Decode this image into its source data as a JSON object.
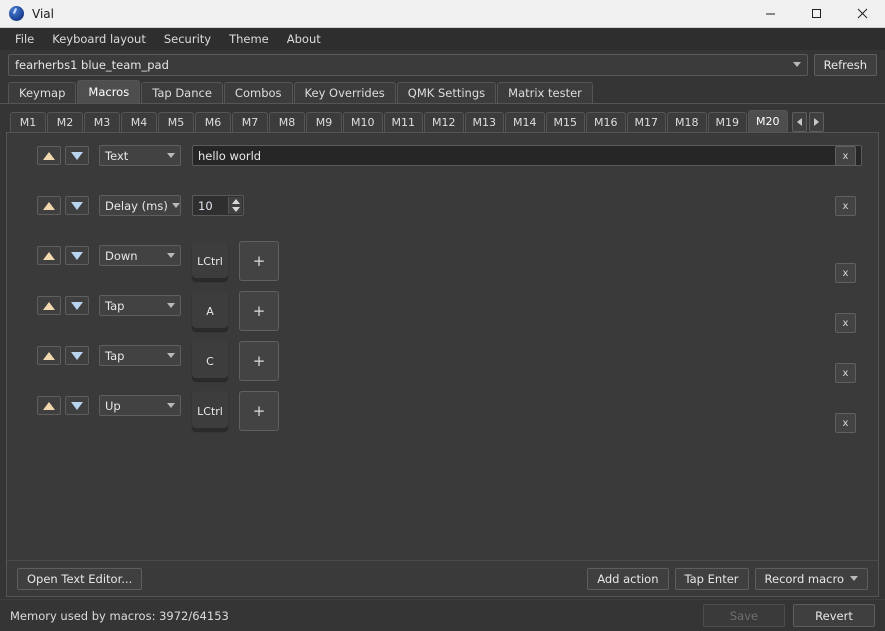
{
  "window": {
    "title": "Vial",
    "icon": "vial-logo-icon",
    "controls": {
      "minimize": "minimize-icon",
      "maximize": "maximize-icon",
      "close": "close-icon"
    }
  },
  "menubar": {
    "items": [
      {
        "label": "File"
      },
      {
        "label": "Keyboard layout"
      },
      {
        "label": "Security"
      },
      {
        "label": "Theme"
      },
      {
        "label": "About"
      }
    ]
  },
  "device": {
    "selected": "fearherbs1 blue_team_pad",
    "refresh_label": "Refresh"
  },
  "main_tabs": {
    "active": "Macros",
    "items": [
      {
        "label": "Keymap"
      },
      {
        "label": "Macros"
      },
      {
        "label": "Tap Dance"
      },
      {
        "label": "Combos"
      },
      {
        "label": "Key Overrides"
      },
      {
        "label": "QMK Settings"
      },
      {
        "label": "Matrix tester"
      }
    ]
  },
  "macro_tabs": {
    "active": "M20",
    "items": [
      {
        "label": "M1"
      },
      {
        "label": "M2"
      },
      {
        "label": "M3"
      },
      {
        "label": "M4"
      },
      {
        "label": "M5"
      },
      {
        "label": "M6"
      },
      {
        "label": "M7"
      },
      {
        "label": "M8"
      },
      {
        "label": "M9"
      },
      {
        "label": "M10"
      },
      {
        "label": "M11"
      },
      {
        "label": "M12"
      },
      {
        "label": "M13"
      },
      {
        "label": "M14"
      },
      {
        "label": "M15"
      },
      {
        "label": "M16"
      },
      {
        "label": "M17"
      },
      {
        "label": "M18"
      },
      {
        "label": "M19"
      },
      {
        "label": "M20"
      }
    ],
    "scroll_left": "scroll-left-icon",
    "scroll_right": "scroll-right-icon"
  },
  "actions": [
    {
      "kind": "text",
      "move_up": "▲",
      "move_down": "▼",
      "type": "Text",
      "value": "hello world",
      "delete": "x"
    },
    {
      "kind": "delay",
      "move_up": "▲",
      "move_down": "▼",
      "type": "Delay (ms)",
      "value": "10",
      "delete": "x"
    },
    {
      "kind": "key",
      "move_up": "▲",
      "move_down": "▼",
      "type": "Down",
      "keys": [
        "LCtrl"
      ],
      "add_key": "+",
      "delete": "x"
    },
    {
      "kind": "key",
      "move_up": "▲",
      "move_down": "▼",
      "type": "Tap",
      "keys": [
        "A"
      ],
      "add_key": "+",
      "delete": "x"
    },
    {
      "kind": "key",
      "move_up": "▲",
      "move_down": "▼",
      "type": "Tap",
      "keys": [
        "C"
      ],
      "add_key": "+",
      "delete": "x"
    },
    {
      "kind": "key",
      "move_up": "▲",
      "move_down": "▼",
      "type": "Up",
      "keys": [
        "LCtrl"
      ],
      "add_key": "+",
      "delete": "x"
    }
  ],
  "panel_footer": {
    "open_text_editor": "Open Text Editor...",
    "add_action": "Add action",
    "tap_enter": "Tap Enter",
    "record_macro": "Record macro"
  },
  "statusbar": {
    "memory_text": "Memory used by macros: 3972/64153",
    "save_label": "Save",
    "save_enabled": false,
    "revert_label": "Revert"
  },
  "colors": {
    "window_bg": "#353535",
    "panel_bg": "#3a3a3a",
    "titlebar_bg": "#f0f0f0",
    "accent_tab": "#4e4e4e",
    "text": "#e0e0e0",
    "arrow_up": "#f3d9b0",
    "arrow_down": "#b9d4ef"
  }
}
